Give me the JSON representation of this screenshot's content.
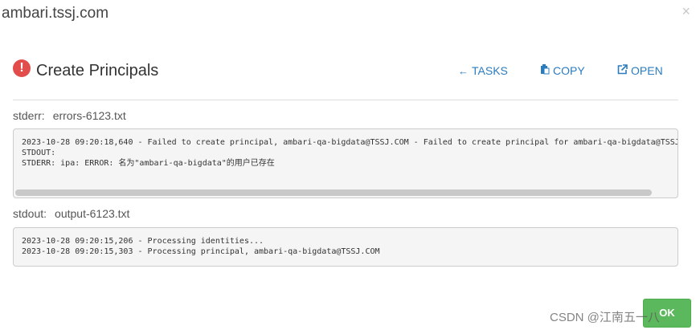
{
  "modal": {
    "title": "ambari.tssj.com",
    "close": "×"
  },
  "task": {
    "title": "Create Principals",
    "status_icon": "error-icon",
    "actions": {
      "tasks": "TASKS",
      "copy": "COPY",
      "open": "OPEN"
    }
  },
  "stderr": {
    "label": "stderr:",
    "filename": "errors-6123.txt",
    "lines": [
      "2023-10-28 09:20:18,640 - Failed to create principal, ambari-qa-bigdata@TSSJ.COM - Failed to create principal for ambari-qa-bigdata@TSSJ",
      "STDOUT:",
      "STDERR: ipa: ERROR: 名为\"ambari-qa-bigdata\"的用户已存在"
    ]
  },
  "stdout": {
    "label": "stdout:",
    "filename": "output-6123.txt",
    "lines": [
      "2023-10-28 09:20:15,206 - Processing identities...",
      "2023-10-28 09:20:15,303 - Processing principal, ambari-qa-bigdata@TSSJ.COM"
    ]
  },
  "footer": {
    "ok": "OK",
    "watermark": "CSDN @江南五一八"
  },
  "colors": {
    "accent": "#2b7cbf",
    "error": "#e24c4b",
    "ok": "#5cb85c"
  }
}
